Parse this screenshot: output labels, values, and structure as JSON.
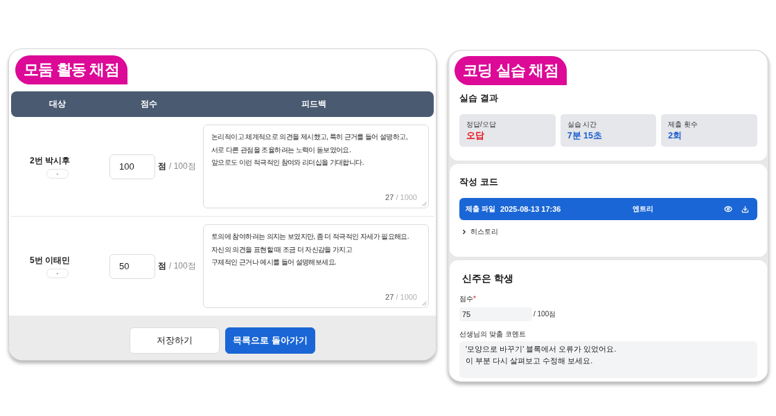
{
  "group_grading": {
    "title": "모둠 활동 채점",
    "columns": [
      "대상",
      "점수",
      "피드백"
    ],
    "rows": [
      {
        "name": "2번 박시후",
        "tag": "-",
        "score": "100",
        "score_unit": "점",
        "score_max": "/ 100점",
        "feedback": "논리적이고 체계적으로 의견을 제시했고, 특히 근거를 들어 설명하고,\n서로 다른 관점을 조율하려는 노력이 돋보였어요.\n앞으로도 이런 적극적인 참여와 리더십을 기대합니다.",
        "char_count": "27",
        "char_limit": "/ 1000"
      },
      {
        "name": "5번 이태민",
        "tag": "-",
        "score": "50",
        "score_unit": "점",
        "score_max": "/ 100점",
        "feedback": "토의에 참여하려는 의지는 보였지만, 좀 더 적극적인 자세가 필요해요.\n자신의 의견을 표현할 때 조금 더 자신감을 가지고\n구체적인 근거나 예시를 들어 설명해보세요.",
        "char_count": "27",
        "char_limit": "/ 1000"
      }
    ],
    "buttons": [
      {
        "label": "저장하기",
        "kind": "secondary"
      },
      {
        "label": "목록으로 돌아가기",
        "kind": "primary"
      }
    ]
  },
  "coding_grading": {
    "title": "코딩 실습 채점",
    "results": {
      "heading": "실습 결과",
      "stats": [
        {
          "label": "정답/오답",
          "value": "오답",
          "color": "#e8101a"
        },
        {
          "label": "실습 시간",
          "value": "7분 15초",
          "color": "#1f5fd1"
        },
        {
          "label": "제출 횟수",
          "value": "2회",
          "color": "#1f5fd1"
        }
      ]
    },
    "code": {
      "heading": "작성 코드",
      "file": {
        "label": "제출 파일",
        "submitted_at": "2025-08-13 17:36",
        "tool": "엔트리"
      },
      "history": {
        "label": "히스토리",
        "expanded": false
      }
    },
    "student": {
      "heading": "신주은 학생",
      "score_label": "점수",
      "required_mark": "*",
      "score": "75",
      "score_max": "/ 100점",
      "comment_label": "선생님의 맞춤 코멘트",
      "comment": "'모양으로 바꾸기' 블록에서 오류가 있었어요.\n이 부분 다시 살펴보고 수정해 보세요."
    }
  }
}
